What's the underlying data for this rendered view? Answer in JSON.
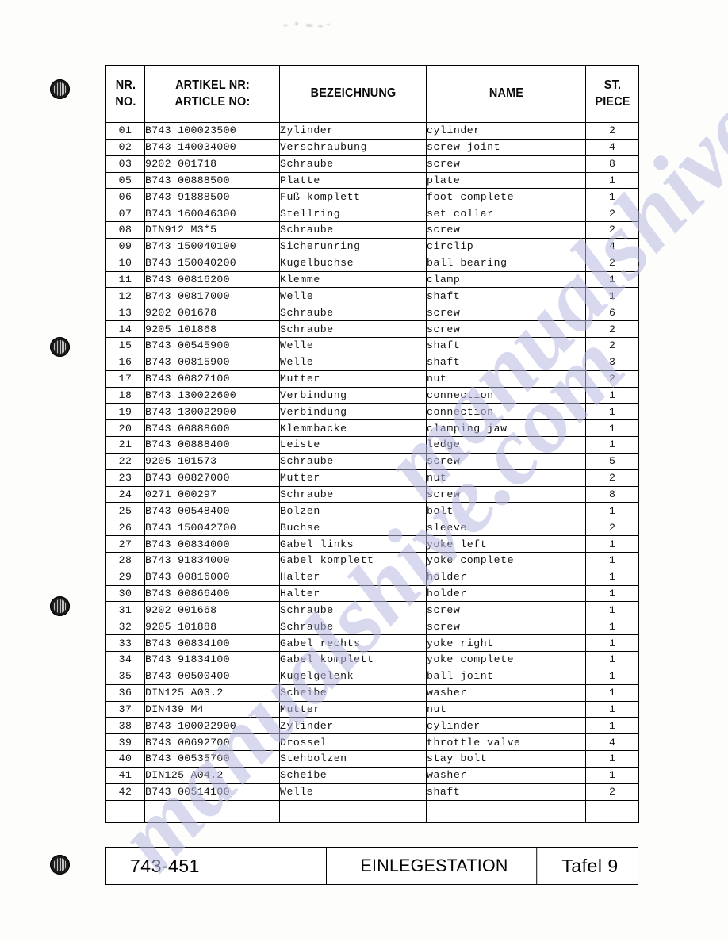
{
  "document": {
    "kind": "spare-parts-list",
    "top_artifact": "illegible-scan-smudge"
  },
  "watermark": {
    "text_primary": "manualshive.com",
    "text_secondary": "manualshive.com",
    "color": "#babae2"
  },
  "table": {
    "headers": {
      "nr_de": "NR.",
      "nr_en": "NO.",
      "article_de": "ARTIKEL NR:",
      "article_en": "ARTICLE NO:",
      "designation": "BEZEICHNUNG",
      "name": "NAME",
      "piece_de": "ST.",
      "piece_en": "PIECE"
    },
    "rows": [
      {
        "nr": "01",
        "article": "B743 100023500",
        "bezeichnung": "Zylinder",
        "name": "cylinder",
        "st": "2"
      },
      {
        "nr": "02",
        "article": "B743 140034000",
        "bezeichnung": "Verschraubung",
        "name": "screw joint",
        "st": "4"
      },
      {
        "nr": "03",
        "article": "9202 001718",
        "bezeichnung": "Schraube",
        "name": "screw",
        "st": "8"
      },
      {
        "nr": "05",
        "article": "B743 00888500",
        "bezeichnung": "Platte",
        "name": "plate",
        "st": "1"
      },
      {
        "nr": "06",
        "article": "B743 91888500",
        "bezeichnung": "Fuß komplett",
        "name": "foot complete",
        "st": "1"
      },
      {
        "nr": "07",
        "article": "B743 160046300",
        "bezeichnung": "Stellring",
        "name": "set collar",
        "st": "2"
      },
      {
        "nr": "08",
        "article": "DIN912 M3*5",
        "bezeichnung": "Schraube",
        "name": "screw",
        "st": "2"
      },
      {
        "nr": "09",
        "article": "B743 150040100",
        "bezeichnung": "Sicherunring",
        "name": "circlip",
        "st": "4"
      },
      {
        "nr": "10",
        "article": "B743 150040200",
        "bezeichnung": "Kugelbuchse",
        "name": "ball bearing",
        "st": "2"
      },
      {
        "nr": "11",
        "article": "B743 00816200",
        "bezeichnung": "Klemme",
        "name": "clamp",
        "st": "1"
      },
      {
        "nr": "12",
        "article": "B743 00817000",
        "bezeichnung": "Welle",
        "name": "shaft",
        "st": "1"
      },
      {
        "nr": "13",
        "article": "9202 001678",
        "bezeichnung": "Schraube",
        "name": "screw",
        "st": "6"
      },
      {
        "nr": "14",
        "article": "9205 101868",
        "bezeichnung": "Schraube",
        "name": "screw",
        "st": "2"
      },
      {
        "nr": "15",
        "article": "B743 00545900",
        "bezeichnung": "Welle",
        "name": "shaft",
        "st": "2"
      },
      {
        "nr": "16",
        "article": "B743 00815900",
        "bezeichnung": "Welle",
        "name": "shaft",
        "st": "3"
      },
      {
        "nr": "17",
        "article": "B743 00827100",
        "bezeichnung": "Mutter",
        "name": "nut",
        "st": "2"
      },
      {
        "nr": "18",
        "article": "B743 130022600",
        "bezeichnung": "Verbindung",
        "name": "connection",
        "st": "1"
      },
      {
        "nr": "19",
        "article": "B743 130022900",
        "bezeichnung": "Verbindung",
        "name": "connection",
        "st": "1"
      },
      {
        "nr": "20",
        "article": "B743 00888600",
        "bezeichnung": "Klemmbacke",
        "name": "clamping jaw",
        "st": "1"
      },
      {
        "nr": "21",
        "article": "B743 00888400",
        "bezeichnung": "Leiste",
        "name": "ledge",
        "st": "1"
      },
      {
        "nr": "22",
        "article": "9205 101573",
        "bezeichnung": "Schraube",
        "name": "screw",
        "st": "5"
      },
      {
        "nr": "23",
        "article": "B743 00827000",
        "bezeichnung": "Mutter",
        "name": "nut",
        "st": "2"
      },
      {
        "nr": "24",
        "article": "0271 000297",
        "bezeichnung": "Schraube",
        "name": "screw",
        "st": "8"
      },
      {
        "nr": "25",
        "article": "B743 00548400",
        "bezeichnung": "Bolzen",
        "name": "bolt",
        "st": "1"
      },
      {
        "nr": "26",
        "article": "B743 150042700",
        "bezeichnung": "Buchse",
        "name": "sleeve",
        "st": "2"
      },
      {
        "nr": "27",
        "article": "B743 00834000",
        "bezeichnung": "Gabel links",
        "name": "yoke left",
        "st": "1"
      },
      {
        "nr": "28",
        "article": "B743 91834000",
        "bezeichnung": "Gabel komplett",
        "name": "yoke complete",
        "st": "1"
      },
      {
        "nr": "29",
        "article": "B743 00816000",
        "bezeichnung": "Halter",
        "name": "holder",
        "st": "1"
      },
      {
        "nr": "30",
        "article": "B743 00866400",
        "bezeichnung": "Halter",
        "name": "holder",
        "st": "1"
      },
      {
        "nr": "31",
        "article": "9202 001668",
        "bezeichnung": "Schraube",
        "name": "screw",
        "st": "1"
      },
      {
        "nr": "32",
        "article": "9205 101888",
        "bezeichnung": "Schraube",
        "name": "screw",
        "st": "1"
      },
      {
        "nr": "33",
        "article": "B743 00834100",
        "bezeichnung": "Gabel rechts",
        "name": "yoke right",
        "st": "1"
      },
      {
        "nr": "34",
        "article": "B743 91834100",
        "bezeichnung": "Gabel komplett",
        "name": "yoke complete",
        "st": "1"
      },
      {
        "nr": "35",
        "article": "B743 00500400",
        "bezeichnung": "Kugelgelenk",
        "name": "ball joint",
        "st": "1"
      },
      {
        "nr": "36",
        "article": "DIN125 A03.2",
        "bezeichnung": "Scheibe",
        "name": "washer",
        "st": "1"
      },
      {
        "nr": "37",
        "article": "DIN439 M4",
        "bezeichnung": "Mutter",
        "name": "nut",
        "st": "1"
      },
      {
        "nr": "38",
        "article": "B743 100022900",
        "bezeichnung": "Zylinder",
        "name": "cylinder",
        "st": "1"
      },
      {
        "nr": "39",
        "article": "B743 00692700",
        "bezeichnung": "Drossel",
        "name": "throttle valve",
        "st": "4"
      },
      {
        "nr": "40",
        "article": "B743 00535700",
        "bezeichnung": "Stehbolzen",
        "name": "stay bolt",
        "st": "1"
      },
      {
        "nr": "41",
        "article": "DIN125 A04.2",
        "bezeichnung": "Scheibe",
        "name": "washer",
        "st": "1"
      },
      {
        "nr": "42",
        "article": "B743 00514100",
        "bezeichnung": "Welle",
        "name": "shaft",
        "st": "2"
      }
    ]
  },
  "footer": {
    "model": "743-451",
    "station": "EINLEGESTATION",
    "sheet": "Tafel 9"
  }
}
